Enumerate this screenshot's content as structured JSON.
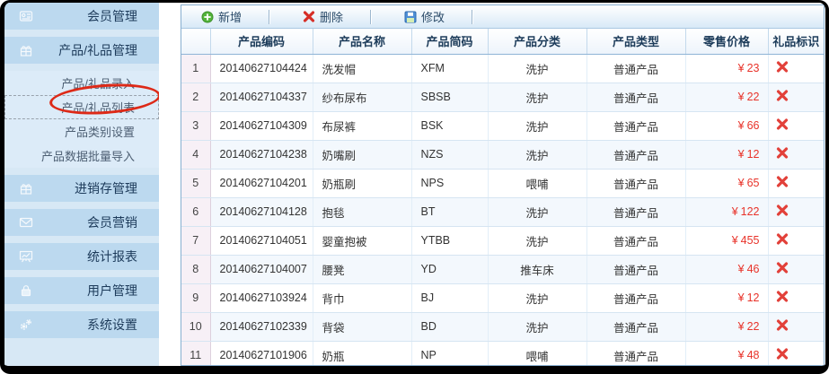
{
  "sidebar": {
    "items": [
      {
        "label": "会员管理",
        "type": "main",
        "icon": "id-card"
      },
      {
        "label": "产品/礼品管理",
        "type": "main",
        "icon": "gift"
      },
      {
        "label": "产品/礼品录入",
        "type": "sub"
      },
      {
        "label": "产品/礼品列表",
        "type": "sub",
        "selected": true,
        "annotation": "red-circle"
      },
      {
        "label": "产品类别设置",
        "type": "sub"
      },
      {
        "label": "产品数据批量导入",
        "type": "sub"
      },
      {
        "label": "进销存管理",
        "type": "main",
        "icon": "box"
      },
      {
        "label": "会员营销",
        "type": "main",
        "icon": "envelope"
      },
      {
        "label": "统计报表",
        "type": "main",
        "icon": "chart-board"
      },
      {
        "label": "用户管理",
        "type": "main",
        "icon": "lock"
      },
      {
        "label": "系统设置",
        "type": "main",
        "icon": "gears"
      }
    ]
  },
  "toolbar": {
    "buttons": [
      {
        "label": "新增",
        "icon": "add-icon"
      },
      {
        "label": "删除",
        "icon": "delete-icon"
      },
      {
        "label": "修改",
        "icon": "save-icon"
      }
    ]
  },
  "table": {
    "currency": "¥",
    "columns": [
      "产品编码",
      "产品名称",
      "产品简码",
      "产品分类",
      "产品类型",
      "零售价格",
      "礼品标识"
    ],
    "rows": [
      {
        "num": "1",
        "code": "20140627104424",
        "name": "洗发帽",
        "short": "XFM",
        "category": "洗护",
        "type": "普通产品",
        "price": "23"
      },
      {
        "num": "2",
        "code": "20140627104337",
        "name": "纱布尿布",
        "short": "SBSB",
        "category": "洗护",
        "type": "普通产品",
        "price": "22"
      },
      {
        "num": "3",
        "code": "20140627104309",
        "name": "布尿裤",
        "short": "BSK",
        "category": "洗护",
        "type": "普通产品",
        "price": "66"
      },
      {
        "num": "4",
        "code": "20140627104238",
        "name": "奶嘴刷",
        "short": "NZS",
        "category": "洗护",
        "type": "普通产品",
        "price": "12"
      },
      {
        "num": "5",
        "code": "20140627104201",
        "name": "奶瓶刷",
        "short": "NPS",
        "category": "喂哺",
        "type": "普通产品",
        "price": "65"
      },
      {
        "num": "6",
        "code": "20140627104128",
        "name": "抱毯",
        "short": "BT",
        "category": "洗护",
        "type": "普通产品",
        "price": "122"
      },
      {
        "num": "7",
        "code": "20140627104051",
        "name": "婴童抱被",
        "short": "YTBB",
        "category": "洗护",
        "type": "普通产品",
        "price": "455"
      },
      {
        "num": "8",
        "code": "20140627104007",
        "name": "腰凳",
        "short": "YD",
        "category": "推车床",
        "type": "普通产品",
        "price": "46"
      },
      {
        "num": "9",
        "code": "20140627103924",
        "name": "背巾",
        "short": "BJ",
        "category": "洗护",
        "type": "普通产品",
        "price": "12"
      },
      {
        "num": "10",
        "code": "20140627102339",
        "name": "背袋",
        "short": "BD",
        "category": "洗护",
        "type": "普通产品",
        "price": "22"
      },
      {
        "num": "11",
        "code": "20140627101906",
        "name": "奶瓶",
        "short": "NP",
        "category": "喂哺",
        "type": "普通产品",
        "price": "48"
      }
    ]
  },
  "colors": {
    "price_red": "#e8332a",
    "annotation_red": "#dd2917",
    "add_green": "#52b43a",
    "delete_red": "#d62f28",
    "sidebar_item_blue": "#bcd9ef"
  }
}
